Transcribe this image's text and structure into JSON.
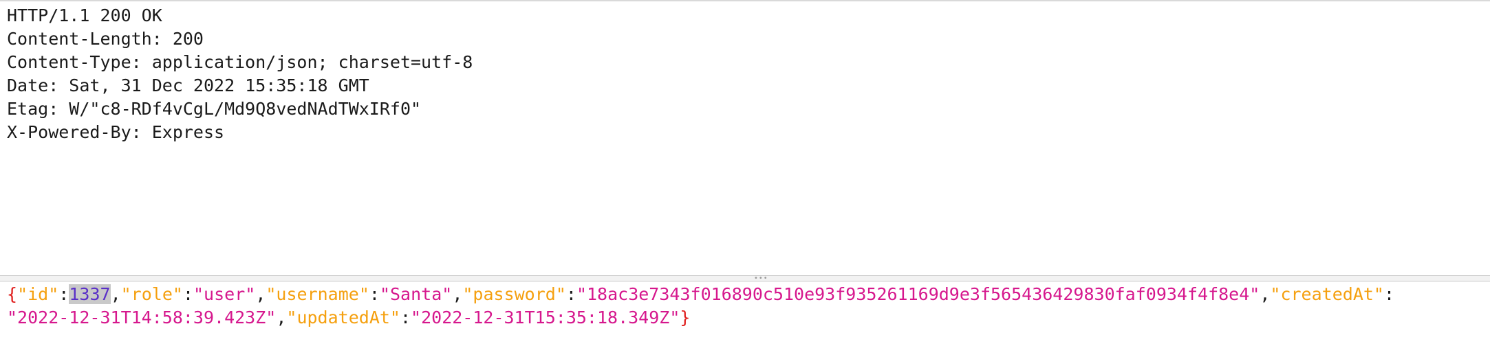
{
  "response_headers": {
    "status_line": "HTTP/1.1 200 OK",
    "content_length": "Content-Length: 200",
    "content_type": "Content-Type: application/json; charset=utf-8",
    "date": "Date: Sat, 31 Dec 2022 15:35:18 GMT",
    "etag": "Etag: W/\"c8-RDf4vCgL/Md9Q8vedNAdTWxIRf0\"",
    "powered_by": "X-Powered-By: Express"
  },
  "json_body": {
    "open_brace": "{",
    "close_brace": "}",
    "colon": ":",
    "comma": ",",
    "id_key": "\"id\"",
    "id_value": "1337",
    "role_key": "\"role\"",
    "role_value": "\"user\"",
    "username_key": "\"username\"",
    "username_value": "\"Santa\"",
    "password_key": "\"password\"",
    "password_value": "\"18ac3e7343f016890c510e93f935261169d9e3f565436429830faf0934f4f8e4\"",
    "createdAt_key": "\"createdAt\"",
    "createdAt_value": "\"2022-12-31T14:58:39.423Z\"",
    "updatedAt_key": "\"updatedAt\"",
    "updatedAt_value": "\"2022-12-31T15:35:18.349Z\""
  },
  "colors": {
    "brace": "#e0201f",
    "key": "#f5a00f",
    "string_value": "#d6178d",
    "number_value": "#5a2fc8",
    "selection": "#c9c9c9"
  },
  "icons": {
    "divider_grip": "grip-dots-icon"
  }
}
